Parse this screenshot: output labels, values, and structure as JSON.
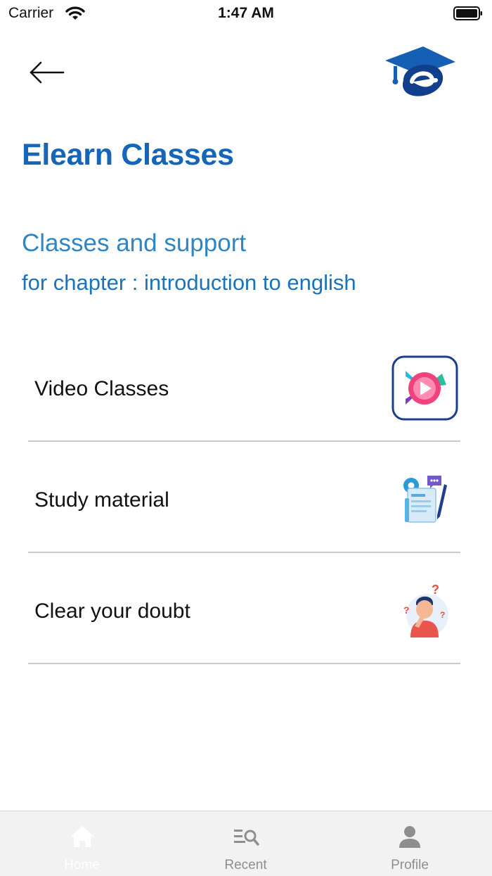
{
  "status_bar": {
    "carrier": "Carrier",
    "time": "1:47 AM"
  },
  "header": {
    "back_icon": "arrow-left-icon",
    "logo": "graduation-cap-e-logo"
  },
  "page": {
    "title": "Elearn Classes",
    "subtitle": "Classes and support",
    "chapter": "for chapter : introduction to english"
  },
  "menu": [
    {
      "label": "Video Classes",
      "icon": "video-play-icon"
    },
    {
      "label": "Study material",
      "icon": "study-material-icon"
    },
    {
      "label": "Clear your doubt",
      "icon": "doubt-person-icon"
    }
  ],
  "tabbar": {
    "tabs": [
      {
        "label": "Home",
        "icon": "home-icon",
        "active": true
      },
      {
        "label": "Recent",
        "icon": "recent-search-icon",
        "active": false
      },
      {
        "label": "Profile",
        "icon": "profile-icon",
        "active": false
      }
    ]
  },
  "colors": {
    "brand": "#1565b8",
    "subtitle": "#2f86c7",
    "divider": "#c9c9c9",
    "tabbar_bg": "#f2f2f2"
  }
}
